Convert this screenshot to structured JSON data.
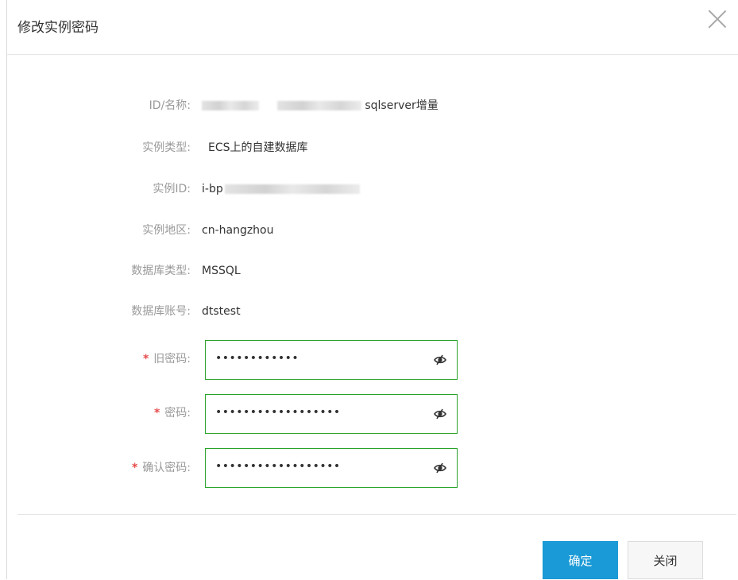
{
  "dialog": {
    "title": "修改实例密码"
  },
  "fields": {
    "id_name": {
      "label": "ID/名称:",
      "value_suffix": "sqlserver增量"
    },
    "instance_type": {
      "label": "实例类型:",
      "value": "ECS上的自建数据库"
    },
    "instance_id": {
      "label": "实例ID:",
      "value_prefix": "i-bp"
    },
    "region": {
      "label": "实例地区:",
      "value": "cn-hangzhou"
    },
    "db_type": {
      "label": "数据库类型:",
      "value": "MSSQL"
    },
    "db_account": {
      "label": "数据库账号:",
      "value": "dtstest"
    }
  },
  "passwords": {
    "required_mark": "*",
    "old": {
      "label": "旧密码:",
      "masked": "••••••••••••"
    },
    "new": {
      "label": "密码:",
      "masked": "••••••••••••••••••"
    },
    "confirm": {
      "label": "确认密码:",
      "masked": "••••••••••••••••••"
    }
  },
  "icons": {
    "close": "close-icon",
    "eye": "eye-hidden-icon"
  },
  "colors": {
    "primary": "#1a9ad6",
    "input_border": "#2aa32a",
    "required": "#e64b4b",
    "label": "#999999"
  },
  "buttons": {
    "confirm": "确定",
    "close": "关闭"
  }
}
